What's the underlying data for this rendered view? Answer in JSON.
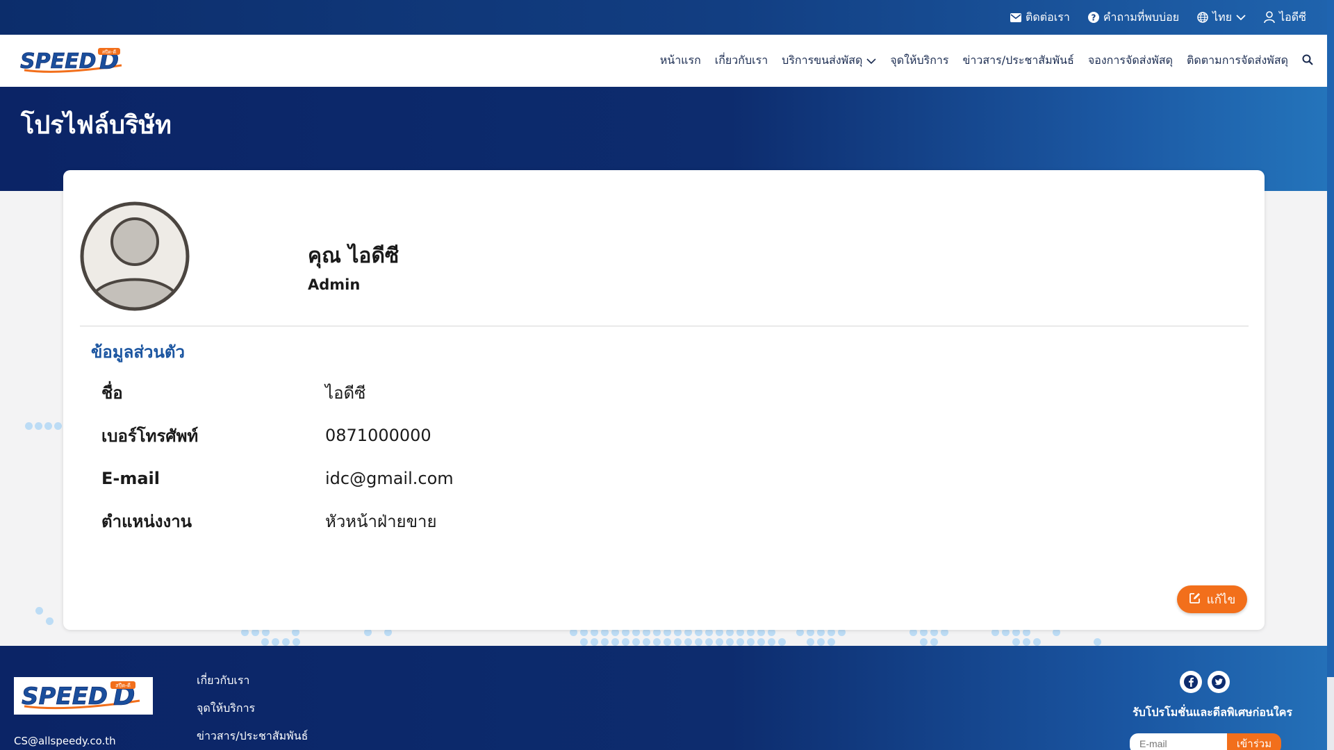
{
  "topbar": {
    "contact": {
      "label": "ติดต่อเรา",
      "icon": "envelope-icon"
    },
    "faq": {
      "label": "คำถามที่พบบ่อย",
      "icon": "question-circle-icon"
    },
    "language": {
      "label": "ไทย",
      "icon": "globe-icon"
    },
    "user": {
      "label": "ไอดีซี",
      "icon": "user-icon"
    }
  },
  "logo": {
    "text": "SPEED",
    "suffix": "D",
    "tag": "สปีด-ดี"
  },
  "nav": {
    "items": [
      "หน้าแรก",
      "เกี่ยวกับเรา",
      "บริการขนส่งพัสดุ",
      "จุดให้บริการ",
      "ข่าวสาร/ประชาสัมพันธ์",
      "จองการจัดส่งพัสดุ",
      "ติดตามการจัดส่งพัสดุ"
    ],
    "search_icon": "search-icon"
  },
  "hero": {
    "title": "โปรไฟล์บริษัท"
  },
  "profile": {
    "name": "คุณ ไอดีซี",
    "role": "Admin",
    "section_title": "ข้อมูลส่วนตัว",
    "fields": [
      {
        "label": "ชื่อ",
        "value": "ไอดีซี"
      },
      {
        "label": "เบอร์โทรศัพท์",
        "value": "0871000000"
      },
      {
        "label": "E-mail",
        "value": "idc@gmail.com"
      },
      {
        "label": "ตำแหน่งงาน",
        "value": "หัวหน้าฝ่ายขาย"
      }
    ],
    "edit_label": "แก้ไข"
  },
  "footer": {
    "email": "CS@allspeedy.co.th",
    "links": [
      "เกี่ยวกับเรา",
      "จุดให้บริการ",
      "ข่าวสาร/ประชาสัมพันธ์"
    ],
    "promo_text": "รับโปรโมชั่นและดีลพิเศษก่อนใคร",
    "email_placeholder": "E-mail",
    "join_label": "เข้าร่วม"
  },
  "colors": {
    "brand_blue": "#0d2c6e",
    "accent_orange": "#f26f1b",
    "section_blue": "#1b55a0"
  }
}
